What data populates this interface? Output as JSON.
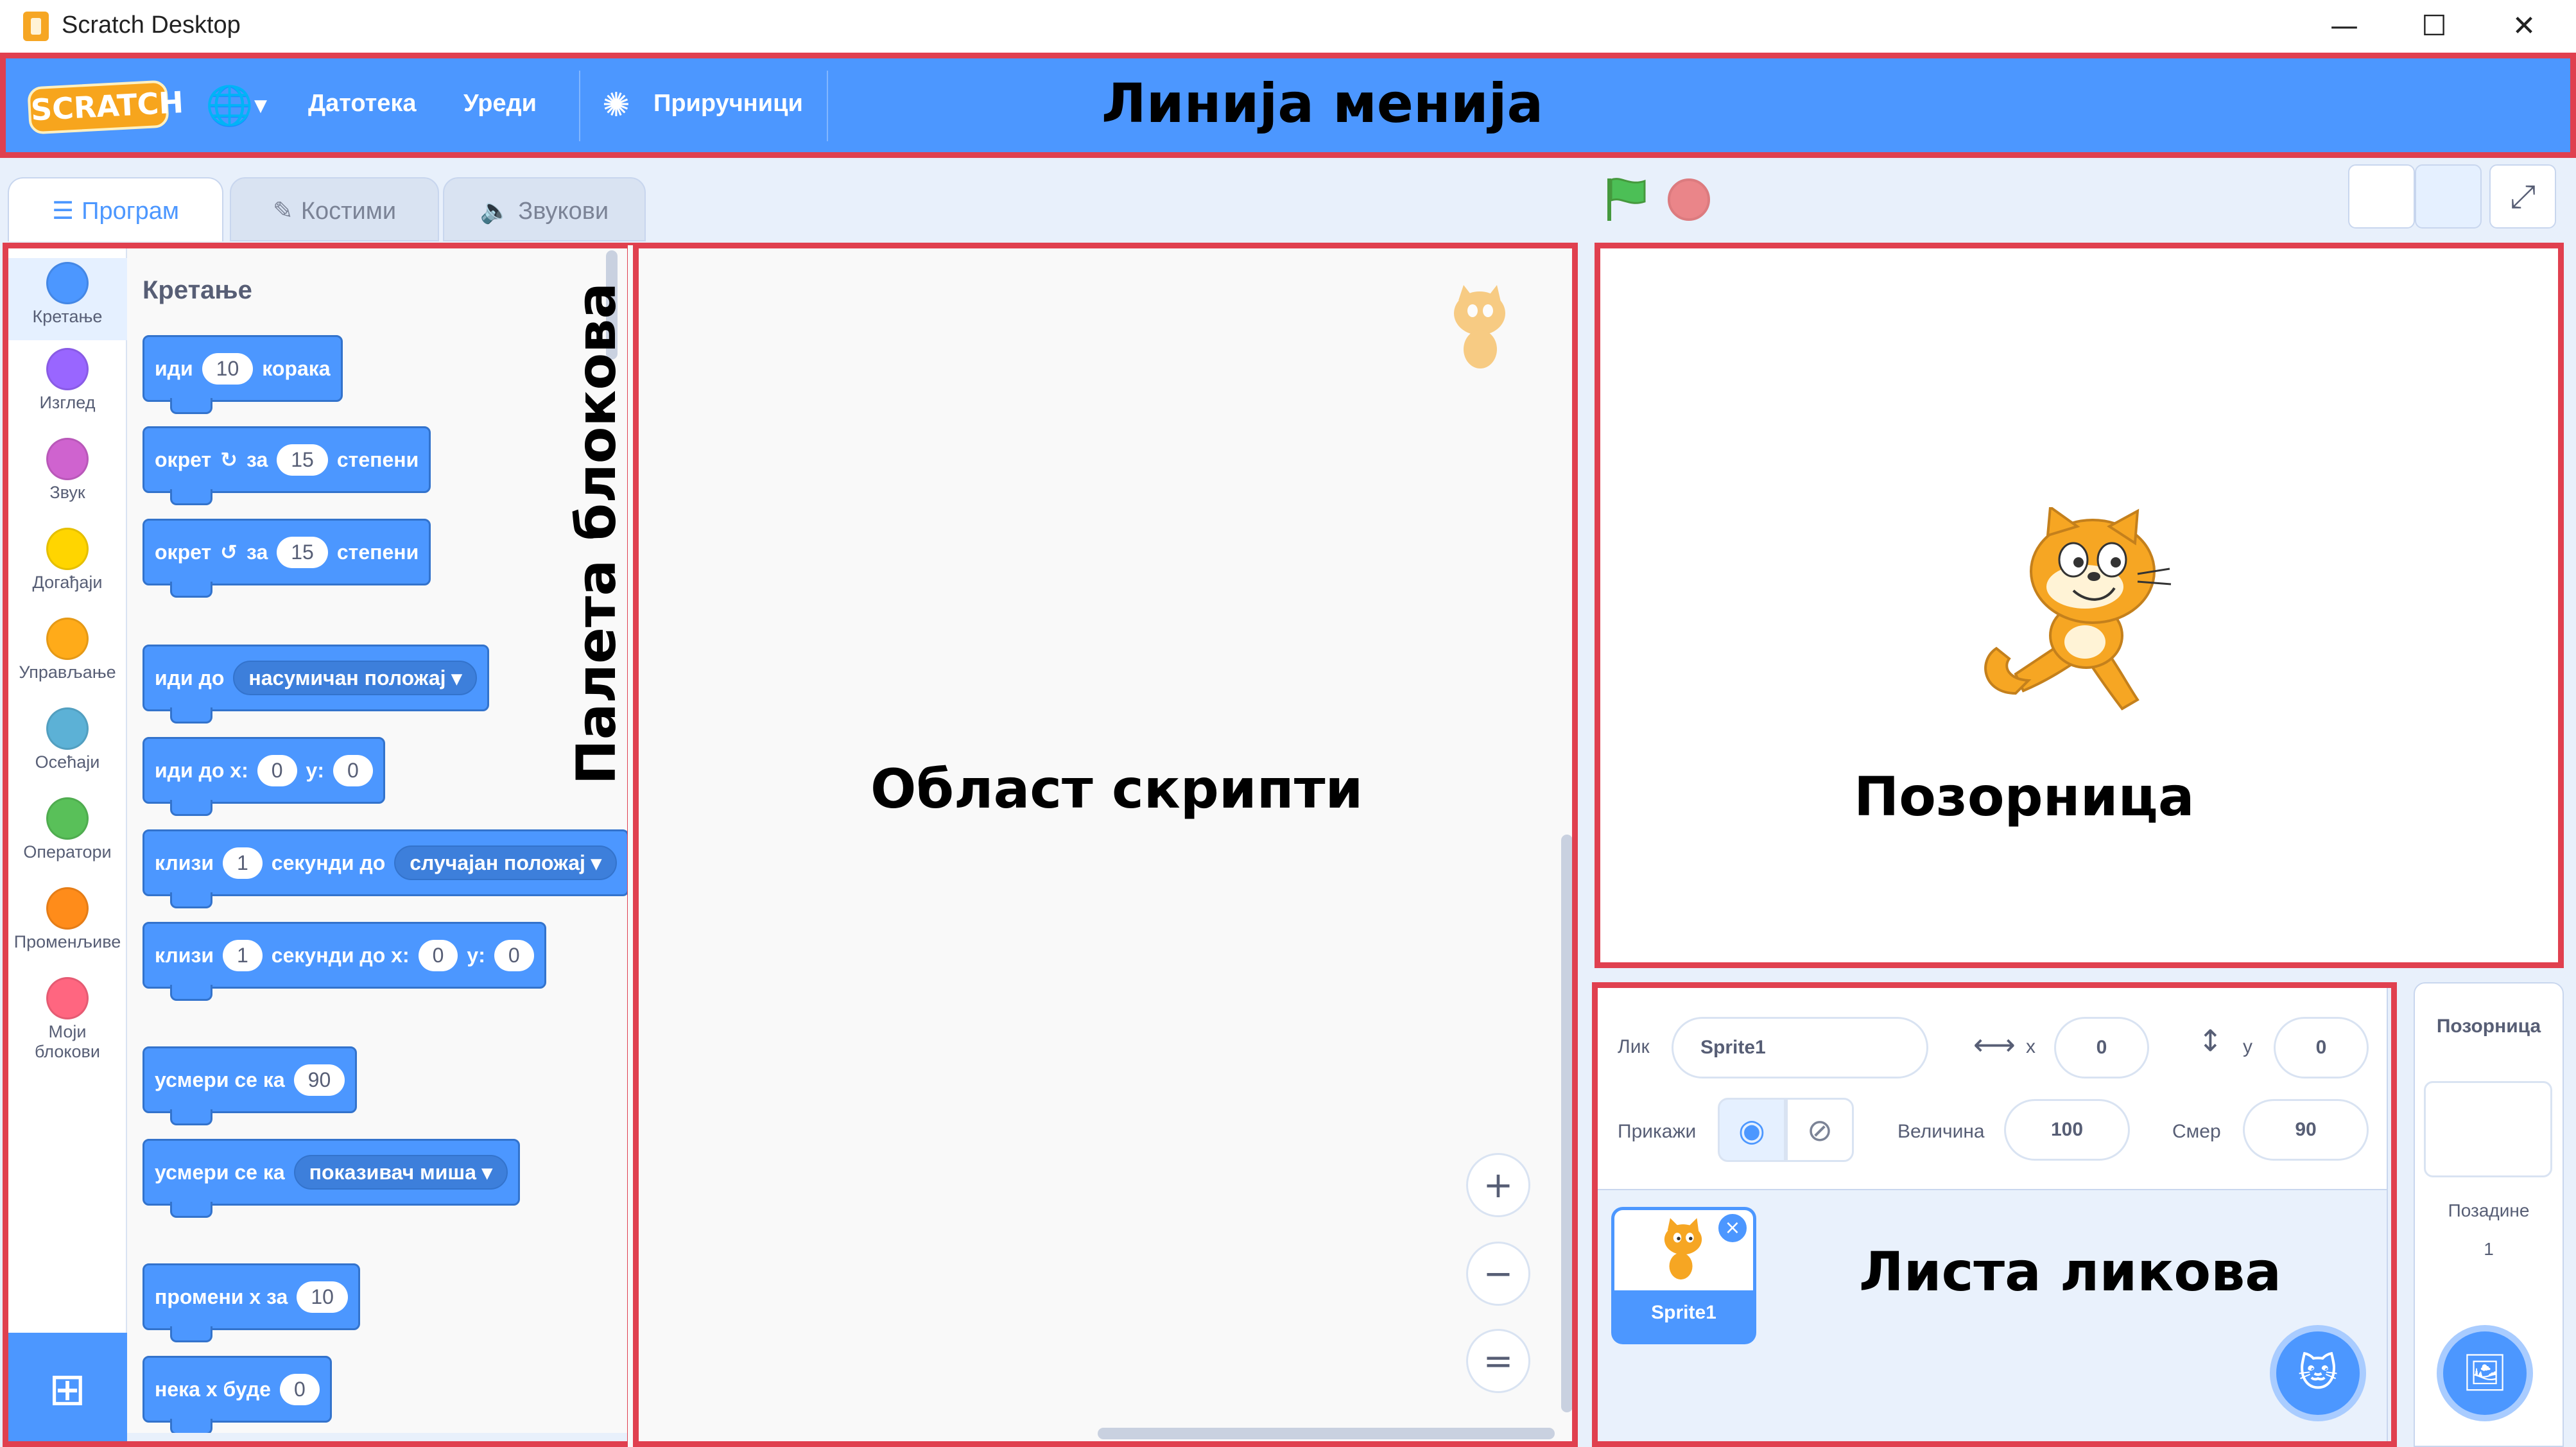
{
  "window": {
    "title": "Scratch Desktop",
    "controls": {
      "minimize": "—",
      "maximize": "☐",
      "close": "✕"
    }
  },
  "menu": {
    "logo": "SCRATCH",
    "file": "Датотека",
    "edit": "Уреди",
    "tutorials": "Приручници",
    "icons": {
      "language": "globe-icon",
      "tutorials": "lightbulb-icon"
    }
  },
  "annotations": {
    "menu_bar": "Линија менија",
    "palette": "Палета блокова",
    "script_area": "Област скрипти",
    "stage": "Позорница",
    "sprite_list": "Листа ликова"
  },
  "tabs": {
    "code": "Програм",
    "costumes": "Костими",
    "sounds": "Звукови"
  },
  "categories": [
    {
      "label": "Кретање",
      "color": "#4c97ff"
    },
    {
      "label": "Изглед",
      "color": "#9966ff"
    },
    {
      "label": "Звук",
      "color": "#cf63cf"
    },
    {
      "label": "Догађаји",
      "color": "#ffd500"
    },
    {
      "label": "Управљање",
      "color": "#ffab19"
    },
    {
      "label": "Осећаји",
      "color": "#5cb1d6"
    },
    {
      "label": "Оператори",
      "color": "#59c059"
    },
    {
      "label": "Променљиве",
      "color": "#ff8c1a"
    },
    {
      "label": "Моји",
      "label2": "блокови",
      "color": "#ff6680"
    }
  ],
  "palette": {
    "title": "Кретање",
    "b1": {
      "t1": "иди",
      "v1": "10",
      "t2": "корака"
    },
    "b2": {
      "t1": "окрет",
      "icon": "↻",
      "t2": "за",
      "v1": "15",
      "t3": "степени"
    },
    "b3": {
      "t1": "окрет",
      "icon": "↺",
      "t2": "за",
      "v1": "15",
      "t3": "степени"
    },
    "b4": {
      "t1": "иди до",
      "dd": "насумичан положај ▾"
    },
    "b5": {
      "t1": "иди до x:",
      "v1": "0",
      "t2": "y:",
      "v2": "0"
    },
    "b6": {
      "t1": "клизи",
      "v1": "1",
      "t2": "секунди до",
      "dd": "случајан положај ▾"
    },
    "b7": {
      "t1": "клизи",
      "v1": "1",
      "t2": "секунди до x:",
      "v2": "0",
      "t3": "y:",
      "v3": "0"
    },
    "b8": {
      "t1": "усмери се ка",
      "v1": "90"
    },
    "b9": {
      "t1": "усмери се ка",
      "dd": "показивач миша ▾"
    },
    "b10": {
      "t1": "промени x за",
      "v1": "10"
    },
    "b11": {
      "t1": "нека x буде",
      "v1": "0"
    }
  },
  "zoom": {
    "in": "+",
    "out": "−",
    "reset": "="
  },
  "sprite_info": {
    "sprite_label": "Лик",
    "sprite_name": "Sprite1",
    "x_label": "x",
    "x_value": "0",
    "y_label": "y",
    "y_value": "0",
    "show_label": "Прикажи",
    "size_label": "Величина",
    "size_value": "100",
    "direction_label": "Смер",
    "direction_value": "90"
  },
  "sprite_list": {
    "sprites": [
      {
        "name": "Sprite1"
      }
    ]
  },
  "stage_panel": {
    "title": "Позорница",
    "backdrops_label": "Позадине",
    "backdrops_count": "1"
  }
}
